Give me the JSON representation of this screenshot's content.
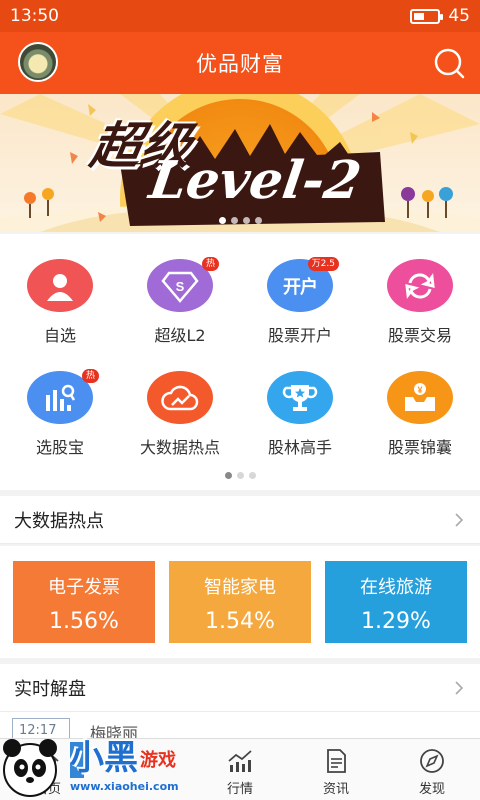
{
  "status_bar": {
    "time": "13:50",
    "battery": "45",
    "battery_level": 0.45
  },
  "header": {
    "title": "优品财富"
  },
  "banner": {
    "headline": "超级",
    "sub": "Level-2",
    "dots": 4,
    "active_dot": 0
  },
  "grid": {
    "items": [
      {
        "label": "自选",
        "icon": "person-icon",
        "color": "#f05454",
        "tag": ""
      },
      {
        "label": "超级L2",
        "icon": "diamond-s-icon",
        "color": "#a06bd6",
        "tag": "热"
      },
      {
        "label": "股票开户",
        "icon": "kaihu-icon",
        "color": "#4b8ff0",
        "tag": "万2.5",
        "glyph": "开户"
      },
      {
        "label": "股票交易",
        "icon": "exchange-icon",
        "color": "#ee4f9c",
        "tag": ""
      },
      {
        "label": "选股宝",
        "icon": "chart-search-icon",
        "color": "#4b8ff0",
        "tag": "热"
      },
      {
        "label": "大数据热点",
        "icon": "cloud-chart-icon",
        "color": "#f4592c",
        "tag": ""
      },
      {
        "label": "股林高手",
        "icon": "trophy-icon",
        "color": "#33a6ee",
        "tag": ""
      },
      {
        "label": "股票锦囊",
        "icon": "yen-box-icon",
        "color": "#f79516",
        "tag": ""
      }
    ],
    "page_dots": 3,
    "active_page": 0
  },
  "hot": {
    "section_title": "大数据热点",
    "cards": [
      {
        "name": "电子发票",
        "value": "1.56%",
        "color": "#f57a35"
      },
      {
        "name": "智能家电",
        "value": "1.54%",
        "color": "#f5a83d"
      },
      {
        "name": "在线旅游",
        "value": "1.29%",
        "color": "#26a0dd"
      }
    ]
  },
  "jiepan": {
    "section_title": "实时解盘",
    "date": "12:17",
    "text": "梅晓丽"
  },
  "tabbar": {
    "tabs": [
      {
        "label": "首页",
        "icon": "home-icon"
      },
      {
        "label": "行情",
        "icon": "market-chart-icon"
      },
      {
        "label": "资讯",
        "icon": "news-doc-icon"
      },
      {
        "label": "发现",
        "icon": "compass-icon"
      }
    ]
  },
  "watermark": {
    "brand": "小黑",
    "suffix": "游戏",
    "url": "www.xiaohei.com"
  }
}
